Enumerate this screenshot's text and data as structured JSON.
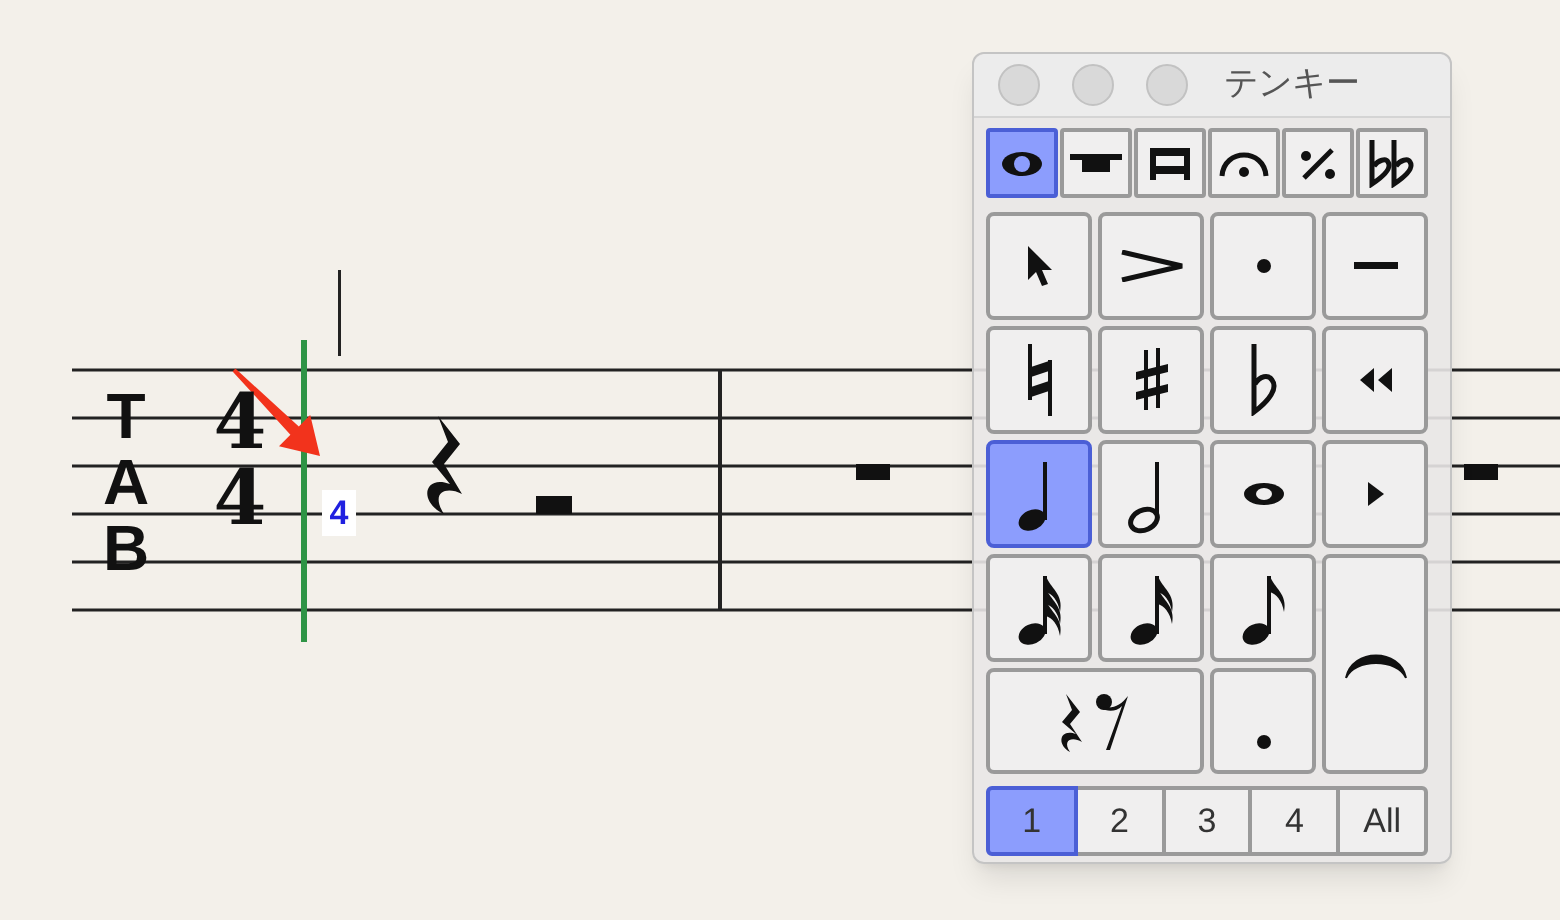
{
  "score": {
    "tab_clef": [
      "T",
      "A",
      "B"
    ],
    "time_signature": {
      "numerator": "4",
      "denominator": "4"
    },
    "cursor_fret": "4"
  },
  "palette": {
    "title": "テンキー",
    "tabs": [
      {
        "kind": "notehead",
        "selected": true
      },
      {
        "kind": "thick-bar",
        "selected": false
      },
      {
        "kind": "double-bar",
        "selected": false
      },
      {
        "kind": "fermata",
        "selected": false
      },
      {
        "kind": "repeat",
        "selected": false
      },
      {
        "kind": "double-flat",
        "selected": false
      }
    ],
    "keys": [
      {
        "kind": "pointer",
        "selected": false
      },
      {
        "kind": "accent",
        "selected": false
      },
      {
        "kind": "staccato",
        "selected": false
      },
      {
        "kind": "tenuto",
        "selected": false
      },
      {
        "kind": "natural",
        "selected": false
      },
      {
        "kind": "sharp",
        "selected": false
      },
      {
        "kind": "flat",
        "selected": false
      },
      {
        "kind": "rewind",
        "selected": false
      },
      {
        "kind": "quarter",
        "selected": true
      },
      {
        "kind": "half",
        "selected": false
      },
      {
        "kind": "whole",
        "selected": false
      },
      {
        "kind": "forward",
        "selected": false
      },
      {
        "kind": "thirty-second",
        "selected": false
      },
      {
        "kind": "sixteenth",
        "selected": false
      },
      {
        "kind": "eighth",
        "selected": false
      },
      {
        "kind": "tie",
        "selected": false
      },
      {
        "kind": "rests",
        "selected": false
      },
      {
        "kind": "dot",
        "selected": false
      }
    ],
    "voices": [
      {
        "label": "1",
        "selected": true
      },
      {
        "label": "2",
        "selected": false
      },
      {
        "label": "3",
        "selected": false
      },
      {
        "label": "4",
        "selected": false
      },
      {
        "label": "All",
        "selected": false
      }
    ]
  }
}
